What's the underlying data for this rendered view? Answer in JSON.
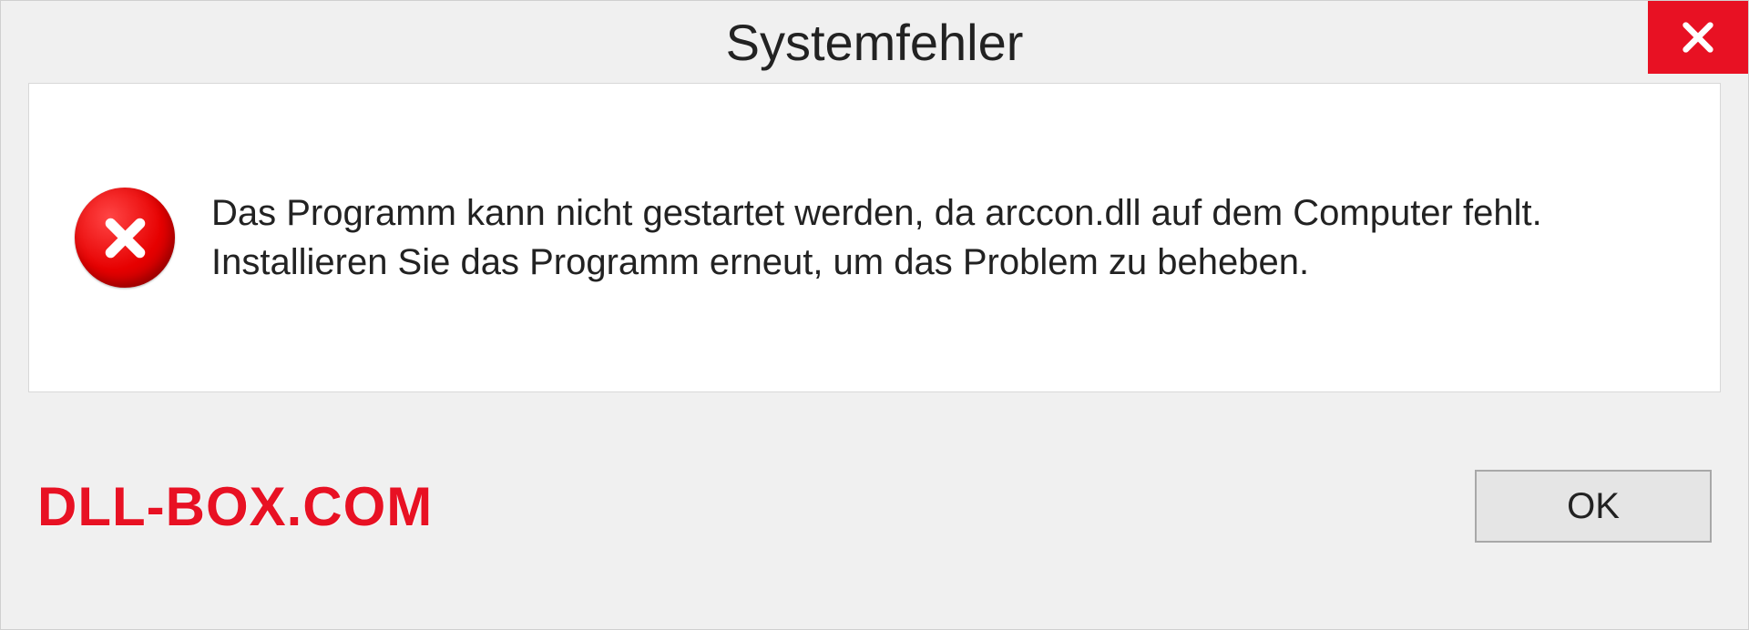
{
  "dialog": {
    "title": "Systemfehler",
    "message": "Das Programm kann nicht gestartet werden, da arccon.dll auf dem Computer fehlt. Installieren Sie das Programm erneut, um das Problem zu beheben.",
    "ok_label": "OK"
  },
  "watermark": "DLL-BOX.COM",
  "colors": {
    "close_button": "#e81123",
    "error_icon": "#e60000",
    "watermark": "#e81123"
  }
}
